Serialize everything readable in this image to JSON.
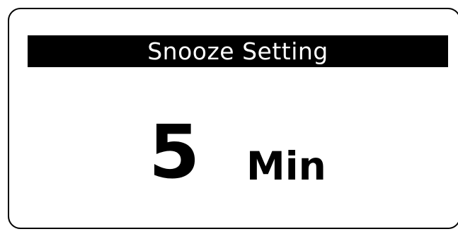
{
  "header": {
    "title": "Snooze Setting"
  },
  "snooze": {
    "value": "5",
    "unit": "Min"
  },
  "colors": {
    "background": "#ffffff",
    "foreground": "#000000",
    "title_bar": "#000000",
    "title_text": "#ffffff"
  }
}
